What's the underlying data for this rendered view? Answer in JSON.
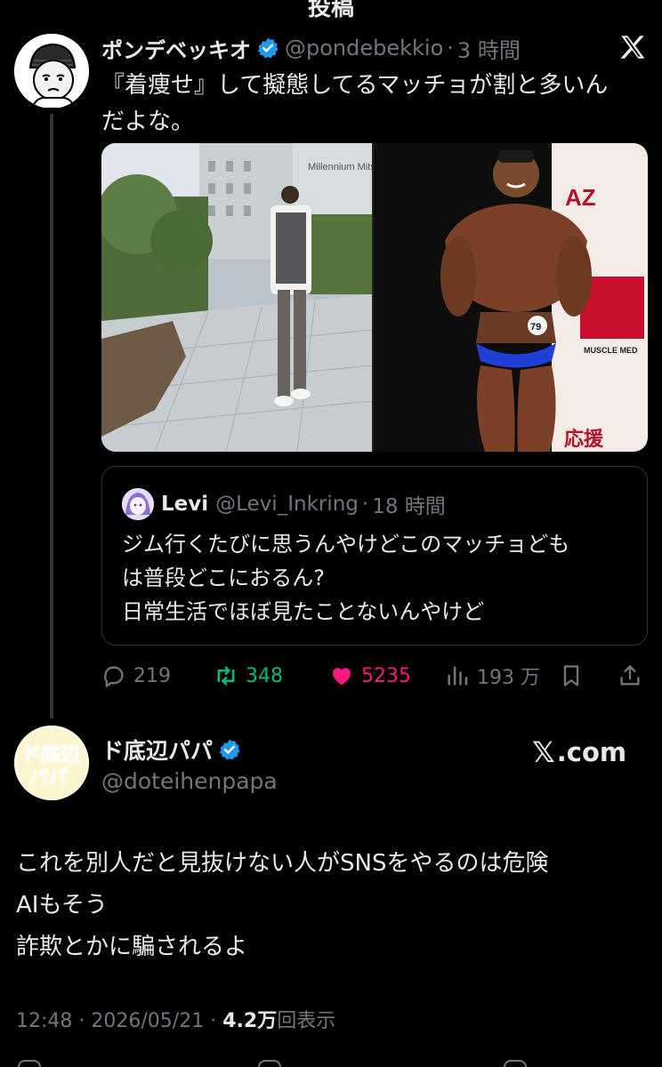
{
  "header": {
    "title": "投稿"
  },
  "tweet1": {
    "display_name": "ポンデベッキオ",
    "handle": "@pondebekkio",
    "separator": "·",
    "time": "3 時間",
    "text_line1": "『着痩せ』して擬態してるマッチョが割と多いん",
    "text_line2": "だよな。",
    "media": {
      "left_sign": "Millennium Mits",
      "right_brand_top": "AZ",
      "right_brand_mid": "MUSCLE MED",
      "right_brand_bottom": "応援",
      "number_badge": "79"
    },
    "quote": {
      "display_name": "Levi",
      "handle": "@Levi_Inkring",
      "separator": "·",
      "time": "18 時間",
      "line1": "ジム行くたびに思うんやけどこのマッチョども",
      "line2": "は普段どこにおるん?",
      "line3": "日常生活でほぼ見たことないんやけど"
    },
    "actions": {
      "replies": "219",
      "reposts": "348",
      "likes": "5235",
      "views": "193 万"
    },
    "colors": {
      "repost": "#00ba7c",
      "like": "#f91880",
      "verified": "#1d9bf0"
    }
  },
  "tweet2": {
    "display_name": "ド底辺パパ",
    "handle": "@doteihenpapa",
    "avatar_text_top": "ド底辺",
    "avatar_text_bottom": "パパ",
    "source_mark": "𝕏",
    "source_text": ".com",
    "line1": "これを別人だと見抜けない人がSNSをやるのは危険",
    "line2": "AIもそう",
    "line3": "詐欺とかに騙されるよ",
    "time": "12:48",
    "date": "2026/05/21",
    "separator": "·",
    "views_value": "4.2万",
    "views_label": "回表示"
  }
}
